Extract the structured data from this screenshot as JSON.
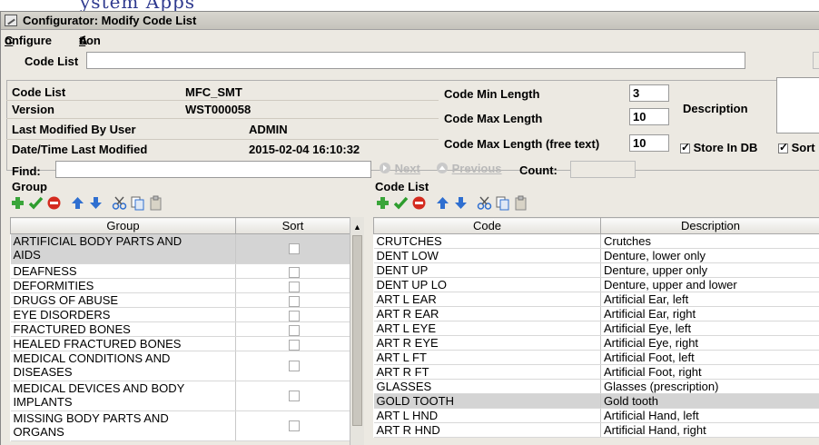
{
  "window": {
    "title": "Configurator: Modify Code List"
  },
  "menu": {
    "configure": "Configure",
    "action": "Action"
  },
  "codelist_bar": {
    "label": "Code List",
    "value": ""
  },
  "details": {
    "code_list_label": "Code List",
    "code_list_value": "MFC_SMT",
    "version_label": "Version",
    "version_value": "WST000058",
    "last_modified_user_label": "Last Modified By User",
    "last_modified_user_value": "ADMIN",
    "datetime_label": "Date/Time Last Modified",
    "datetime_value": "2015-02-04 16:10:32",
    "min_length_label": "Code Min Length",
    "min_length_value": "3",
    "max_length_label": "Code Max Length",
    "max_length_value": "10",
    "max_length_free_label": "Code Max Length (free text)",
    "max_length_free_value": "10",
    "description_label": "Description",
    "description_value": "",
    "store_in_db_label": "Store In DB",
    "store_in_db_checked": true,
    "sort_label": "Sort",
    "sort_checked": true
  },
  "find": {
    "label": "Find:",
    "value": "",
    "next_label": "Next",
    "previous_label": "Previous",
    "count_label": "Count:",
    "count_value": ""
  },
  "group_panel": {
    "title": "Group",
    "columns": [
      "Group",
      "Sort"
    ],
    "rows": [
      {
        "group": [
          "ARTIFICIAL BODY PARTS AND",
          "AIDS"
        ],
        "sort": false,
        "selected": true
      },
      {
        "group": [
          "DEAFNESS"
        ],
        "sort": false,
        "selected": false
      },
      {
        "group": [
          "DEFORMITIES"
        ],
        "sort": false,
        "selected": false
      },
      {
        "group": [
          "DRUGS OF ABUSE"
        ],
        "sort": false,
        "selected": false
      },
      {
        "group": [
          "EYE DISORDERS"
        ],
        "sort": false,
        "selected": false
      },
      {
        "group": [
          "FRACTURED BONES"
        ],
        "sort": false,
        "selected": false
      },
      {
        "group": [
          "HEALED FRACTURED BONES"
        ],
        "sort": false,
        "selected": false
      },
      {
        "group": [
          "MEDICAL CONDITIONS AND",
          "DISEASES"
        ],
        "sort": false,
        "selected": false
      },
      {
        "group": [
          "MEDICAL DEVICES AND BODY",
          "IMPLANTS"
        ],
        "sort": false,
        "selected": false
      },
      {
        "group": [
          "MISSING BODY PARTS AND",
          "ORGANS"
        ],
        "sort": false,
        "selected": false
      }
    ]
  },
  "code_panel": {
    "title": "Code List",
    "columns": [
      "Code",
      "Description"
    ],
    "rows": [
      {
        "code": "CRUTCHES",
        "description": "Crutches",
        "selected": false
      },
      {
        "code": "DENT LOW",
        "description": "Denture, lower only",
        "selected": false
      },
      {
        "code": "DENT UP",
        "description": "Denture, upper only",
        "selected": false
      },
      {
        "code": "DENT UP LO",
        "description": "Denture, upper and lower",
        "selected": false
      },
      {
        "code": "ART L EAR",
        "description": "Artificial Ear, left",
        "selected": false
      },
      {
        "code": "ART R EAR",
        "description": "Artificial Ear, right",
        "selected": false
      },
      {
        "code": "ART L EYE",
        "description": "Artificial Eye, left",
        "selected": false
      },
      {
        "code": "ART R EYE",
        "description": "Artificial Eye, right",
        "selected": false
      },
      {
        "code": "ART L FT",
        "description": "Artificial Foot, left",
        "selected": false
      },
      {
        "code": "ART R FT",
        "description": "Artificial Foot, right",
        "selected": false
      },
      {
        "code": "GLASSES",
        "description": "Glasses (prescription)",
        "selected": false
      },
      {
        "code": "GOLD TOOTH",
        "description": "Gold tooth",
        "selected": true
      },
      {
        "code": "ART L HND",
        "description": "Artificial Hand, left",
        "selected": false
      },
      {
        "code": "ART R HND",
        "description": "Artificial Hand, right",
        "selected": false
      }
    ]
  },
  "toolbar_icons": [
    "add-icon",
    "accept-icon",
    "delete-icon",
    "move-up-icon",
    "move-down-icon",
    "cut-icon",
    "copy-icon",
    "paste-icon"
  ],
  "colors": {
    "add": "#3aa53a",
    "accept": "#2e9d2e",
    "delete": "#d42b1f",
    "arrow": "#2f6fd0",
    "selected_row": "#d4d4d4"
  }
}
